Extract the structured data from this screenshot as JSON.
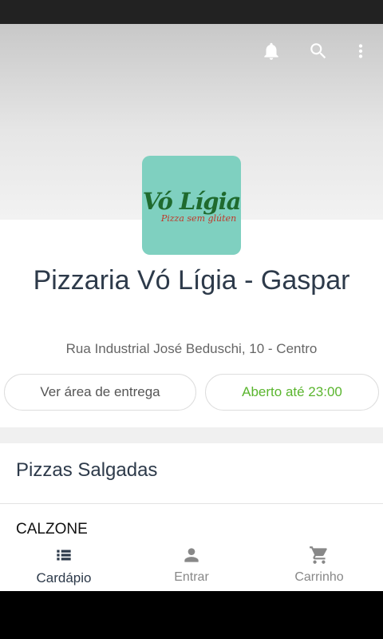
{
  "header": {
    "icons": [
      "bell-icon",
      "search-icon",
      "more-vert-icon"
    ]
  },
  "store": {
    "logo_title": "Vó Lígia",
    "logo_subtitle": "Pizza sem glúten",
    "name": "Pizzaria Vó Lígia - Gaspar",
    "address": "Rua Industrial José Beduschi, 10 - Centro",
    "delivery_button": "Ver área de entrega",
    "open_status": "Aberto até 23:00"
  },
  "menu": {
    "section_title": "Pizzas Salgadas",
    "category": "CALZONE"
  },
  "bottom_nav": {
    "items": [
      {
        "label": "Cardápio",
        "icon": "list-icon",
        "active": true
      },
      {
        "label": "Entrar",
        "icon": "person-icon",
        "active": false
      },
      {
        "label": "Carrinho",
        "icon": "cart-icon",
        "active": false
      }
    ]
  },
  "colors": {
    "open_status": "#5ab52e",
    "logo_background": "#7fd0c0",
    "title_text": "#2d3a4a"
  }
}
